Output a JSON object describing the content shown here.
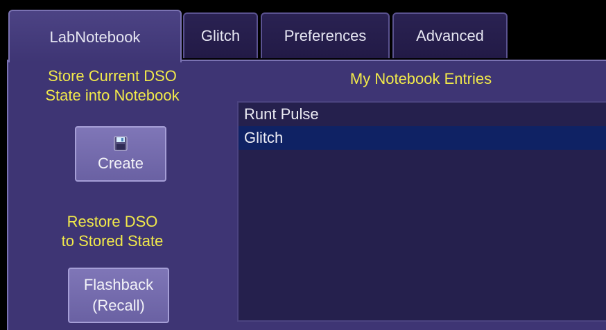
{
  "tabs": [
    {
      "label": "LabNotebook",
      "active": true
    },
    {
      "label": "Glitch",
      "active": false
    },
    {
      "label": "Preferences",
      "active": false
    },
    {
      "label": "Advanced",
      "active": false
    }
  ],
  "store": {
    "line1": "Store Current DSO",
    "line2": "State into Notebook",
    "create_label": "Create",
    "create_icon": "floppy-disk-icon"
  },
  "restore": {
    "line1": "Restore DSO",
    "line2": "to Stored State",
    "flashback_line1": "Flashback",
    "flashback_line2": "(Recall)"
  },
  "entries": {
    "title": "My Notebook Entries",
    "items": [
      "Runt Pulse",
      "Glitch"
    ],
    "selected_index": 1
  },
  "colors": {
    "panel": "#3e3574",
    "heading_text": "#f2ea4a",
    "selection": "#0f2264"
  }
}
